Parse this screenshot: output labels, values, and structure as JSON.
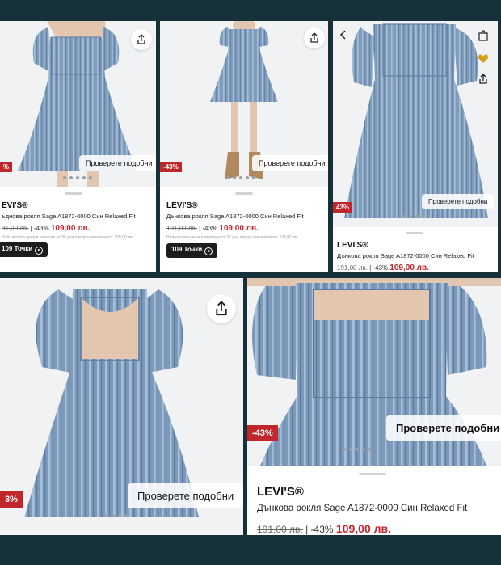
{
  "products": [
    {
      "brand": "EVI'S®",
      "name": "ъднова рокля Sage A1872-0000 Син Relaxed Fit",
      "old_price": "91,00 лв.",
      "discount": "-43%",
      "new_price": "109,00 лв.",
      "note": "Най-ниската цена в периода от 30 дни преди намалението: 105,00 лв.",
      "points": "109 Точки",
      "badge": "%",
      "similar_button": "Проверете подобни"
    },
    {
      "brand": "LEVI'S®",
      "name": "Дънкова рокля Sage A1872-0000 Син Relaxed Fit",
      "old_price": "191,00 лв.",
      "discount": "-43%",
      "new_price": "109,00 лв.",
      "note": "Най-ниската цена в периода от 30 дни преди намалението: 105,00 лв.",
      "points": "109 Точки",
      "badge": "-43%",
      "similar_button": "Проверете подобни"
    },
    {
      "brand": "LEVI'S®",
      "name": "Дънкова рокля Sage A1872-0000 Син Relaxed Fit",
      "old_price": "191,00 лв.",
      "discount": "-43%",
      "new_price": "109,00 лв.",
      "badge": "43%",
      "similar_button": "Проверете подобни"
    },
    {
      "badge": "3%",
      "similar_button": "Проверете подобни"
    },
    {
      "brand": "LEVI'S®",
      "name": "Дънкова рокля Sage A1872-0000 Син Relaxed Fit",
      "old_price": "191,00 лв.",
      "discount": "-43%",
      "new_price": "109,00 лв.",
      "badge": "-43%",
      "similar_button": "Проверете подобни"
    }
  ],
  "colors": {
    "background": "#17313a",
    "discount": "#c0272d",
    "denim": "#7f9cbc",
    "favorite": "#d4a017"
  },
  "icons": [
    "share-icon",
    "back-chevron-icon",
    "bag-icon",
    "heart-icon"
  ]
}
